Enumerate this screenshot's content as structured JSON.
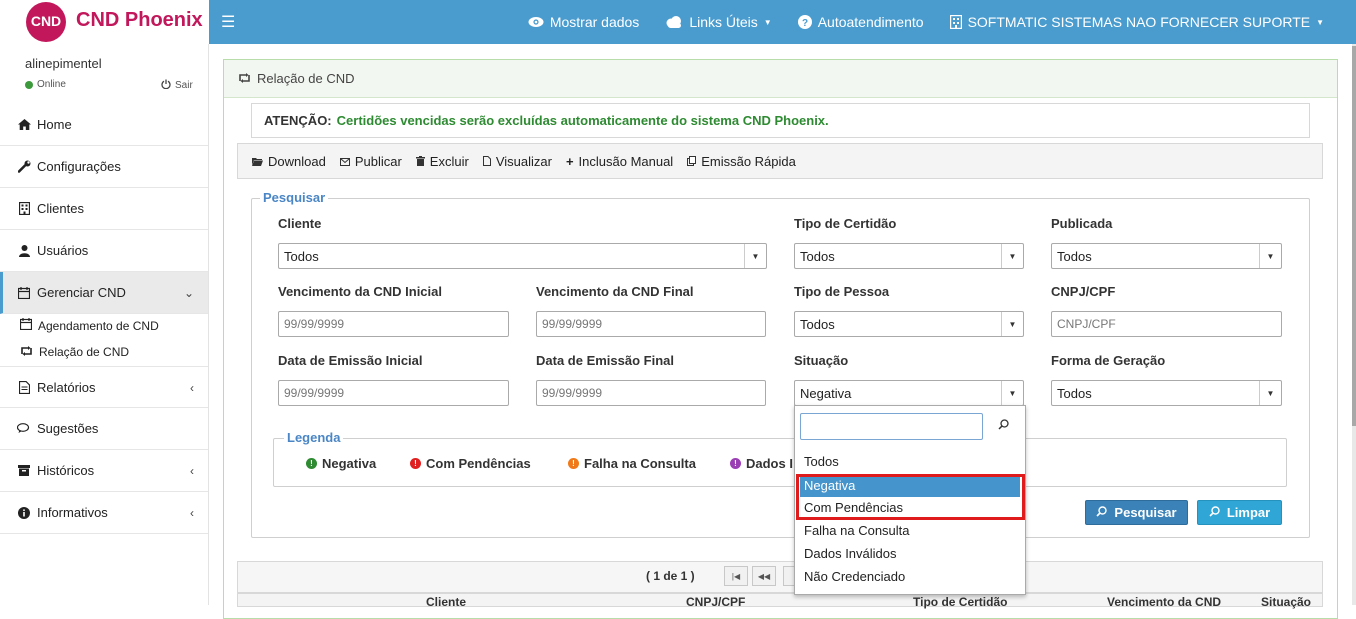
{
  "brand": {
    "logo_short": "CND",
    "name": "CND Phoenix"
  },
  "topnav": [
    {
      "label": "Mostrar dados",
      "icon": "eye-icon"
    },
    {
      "label": "Links Úteis",
      "icon": "cloud-icon",
      "dropdown": true
    },
    {
      "label": "Autoatendimento",
      "icon": "question-circle-icon"
    },
    {
      "label": "SOFTMATIC SISTEMAS NAO FORNECER SUPORTE",
      "icon": "building-icon",
      "dropdown": true
    }
  ],
  "sidebar": {
    "user": "alinepimentel",
    "status": "Online",
    "logout": "Sair",
    "items": [
      {
        "label": "Home",
        "icon": "home-icon"
      },
      {
        "label": "Configurações",
        "icon": "wrench-icon"
      },
      {
        "label": "Clientes",
        "icon": "building-icon"
      },
      {
        "label": "Usuários",
        "icon": "user-icon"
      },
      {
        "label": "Gerenciar CND",
        "icon": "calendar-icon",
        "expanded": true
      },
      {
        "label": "Relatórios",
        "icon": "file-icon"
      },
      {
        "label": "Sugestões",
        "icon": "comments-icon"
      },
      {
        "label": "Históricos",
        "icon": "archive-icon"
      },
      {
        "label": "Informativos",
        "icon": "info-circle-icon"
      }
    ],
    "subitems": [
      {
        "label": "Agendamento de CND",
        "icon": "calendar-icon"
      },
      {
        "label": "Relação de CND",
        "icon": "retweet-icon"
      }
    ]
  },
  "panel_title": "Relação de CND",
  "alert": {
    "label": "ATENÇÃO:",
    "message": "Certidões vencidas serão excluídas automaticamente do sistema CND Phoenix."
  },
  "toolbar": [
    "Download",
    "Publicar",
    "Excluir",
    "Visualizar",
    "Inclusão Manual",
    "Emissão Rápida"
  ],
  "search": {
    "legend": "Pesquisar",
    "cliente": {
      "label": "Cliente",
      "value": "Todos"
    },
    "tipo_certidao": {
      "label": "Tipo de Certidão",
      "value": "Todos"
    },
    "publicada": {
      "label": "Publicada",
      "value": "Todos"
    },
    "venc_inicial": {
      "label": "Vencimento da CND Inicial",
      "placeholder": "99/99/9999"
    },
    "venc_final": {
      "label": "Vencimento da CND Final",
      "placeholder": "99/99/9999"
    },
    "tipo_pessoa": {
      "label": "Tipo de Pessoa",
      "value": "Todos"
    },
    "cnpj": {
      "label": "CNPJ/CPF",
      "placeholder": "CNPJ/CPF"
    },
    "emissao_inicial": {
      "label": "Data de Emissão Inicial",
      "placeholder": "99/99/9999"
    },
    "emissao_final": {
      "label": "Data de Emissão Final",
      "placeholder": "99/99/9999"
    },
    "situacao": {
      "label": "Situação",
      "value": "Negativa"
    },
    "forma_geracao": {
      "label": "Forma de Geração",
      "value": "Todos"
    }
  },
  "legenda": {
    "title": "Legenda",
    "items": [
      {
        "label": "Negativa",
        "color": "#2e8b32"
      },
      {
        "label": "Com Pendências",
        "color": "#e02020"
      },
      {
        "label": "Falha na Consulta",
        "color": "#f07a1a"
      },
      {
        "label": "Dados I",
        "color": "#9b3fb5"
      }
    ]
  },
  "buttons": {
    "search": "Pesquisar",
    "clear": "Limpar"
  },
  "dropdown_options": [
    "Todos",
    "Negativa",
    "Com Pendências",
    "Falha na Consulta",
    "Dados Inválidos",
    "Não Credenciado"
  ],
  "dropdown_selected": "Negativa",
  "pager": {
    "text": "( 1 de 1 )"
  },
  "table_headers": [
    "Cliente",
    "CNPJ/CPF",
    "Tipo de Certidão",
    "Vencimento da CND",
    "Situação"
  ],
  "colors": {
    "topbar": "#4a9ccf",
    "brand": "#c2185b",
    "accent_green": "#2e8b32",
    "legend_blue": "#4a86c5",
    "highlight": "#4594cc",
    "annotation_red": "#e01b1b"
  }
}
